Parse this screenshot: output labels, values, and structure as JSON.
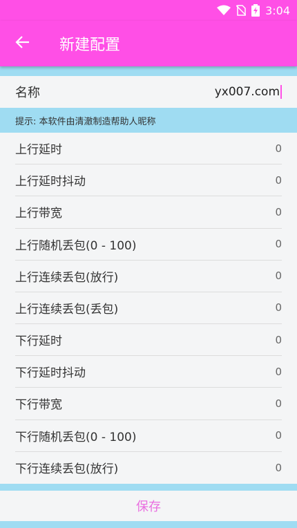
{
  "status_bar": {
    "time": "3:04",
    "icons": [
      "wifi-icon",
      "no-sim-icon",
      "battery-charging-icon"
    ]
  },
  "app_bar": {
    "title": "新建配置",
    "back_icon": "arrow-left-icon"
  },
  "name_field": {
    "label": "名称",
    "value": "yx007.com"
  },
  "hint": "提示: 本软件由清澈制造帮助人昵称",
  "settings": [
    {
      "label": "上行延时",
      "value": "0"
    },
    {
      "label": "上行延时抖动",
      "value": "0"
    },
    {
      "label": "上行带宽",
      "value": "0"
    },
    {
      "label": "上行随机丢包(0 - 100)",
      "value": "0"
    },
    {
      "label": "上行连续丢包(放行)",
      "value": "0"
    },
    {
      "label": "上行连续丢包(丢包)",
      "value": "0"
    },
    {
      "label": "下行延时",
      "value": "0"
    },
    {
      "label": "下行延时抖动",
      "value": "0"
    },
    {
      "label": "下行带宽",
      "value": "0"
    },
    {
      "label": "下行随机丢包(0 - 100)",
      "value": "0"
    },
    {
      "label": "下行连续丢包(放行)",
      "value": "0"
    }
  ],
  "save_label": "保存",
  "colors": {
    "primary": "#ff4fe6",
    "accent_light": "#9fdcf2",
    "save_text": "#e96fe0"
  }
}
